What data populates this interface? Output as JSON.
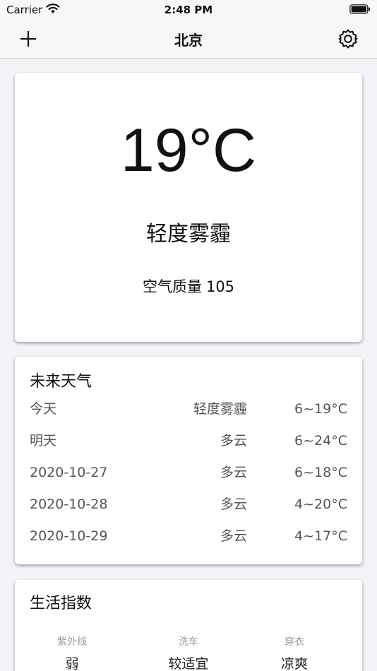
{
  "status_bar": {
    "carrier": "Carrier",
    "time": "2:48 PM"
  },
  "nav": {
    "title": "北京",
    "add_icon": "plus-icon",
    "settings_icon": "gear-icon"
  },
  "current": {
    "temperature": "19°C",
    "condition": "轻度雾霾",
    "aqi_label": "空气质量",
    "aqi_value": "105"
  },
  "forecast": {
    "title": "未来天气",
    "rows": [
      {
        "day": "今天",
        "condition": "轻度雾霾",
        "temp": "6~19°C"
      },
      {
        "day": "明天",
        "condition": "多云",
        "temp": "6~24°C"
      },
      {
        "day": "2020-10-27",
        "condition": "多云",
        "temp": "6~18°C"
      },
      {
        "day": "2020-10-28",
        "condition": "多云",
        "temp": "4~20°C"
      },
      {
        "day": "2020-10-29",
        "condition": "多云",
        "temp": "4~17°C"
      }
    ]
  },
  "life": {
    "title": "生活指数",
    "items": [
      {
        "label": "紫外线",
        "value": "弱"
      },
      {
        "label": "洗车",
        "value": "较适宜"
      },
      {
        "label": "穿衣",
        "value": "凉爽"
      }
    ]
  }
}
